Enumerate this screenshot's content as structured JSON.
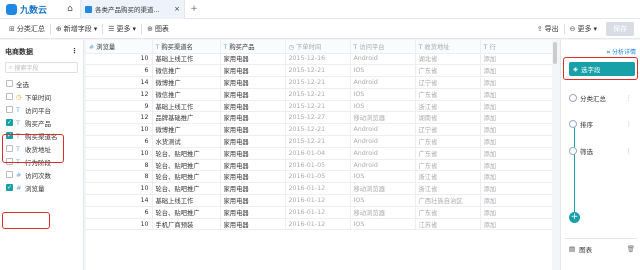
{
  "app": {
    "logo_text": "九数云",
    "tab_title": "各类产品购买的渠道...",
    "home_icon": "home-icon"
  },
  "toolbar": {
    "group_label": "分类汇总",
    "add_field_label": "新增字段",
    "more_label": "更多",
    "chart_label": "图表",
    "export_label": "导出",
    "more2_label": "更多",
    "save_label": "保存"
  },
  "left_panel": {
    "title": "电商数据",
    "search_placeholder": "搜索字段",
    "select_all": "全选",
    "fields": [
      {
        "name": "下单时间",
        "type": "clock",
        "checked": false
      },
      {
        "name": "访问平台",
        "type": "T",
        "checked": false
      },
      {
        "name": "购买产品",
        "type": "T",
        "checked": true
      },
      {
        "name": "购买渠道名",
        "type": "T",
        "checked": true
      },
      {
        "name": "收货地址",
        "type": "T",
        "checked": false
      },
      {
        "name": "行为阶段",
        "type": "T",
        "checked": false
      },
      {
        "name": "访问次数",
        "type": "#",
        "checked": false
      },
      {
        "name": "浏览量",
        "type": "#",
        "checked": true
      }
    ]
  },
  "table": {
    "columns": [
      "浏览量",
      "购买渠道名",
      "购买产品",
      "下单时间",
      "访问平台",
      "收货地址",
      "行"
    ],
    "rows": [
      [
        "10",
        "基础上线工作",
        "家用电器",
        "2015-12-16",
        "Android",
        "湖北省",
        "添加"
      ],
      [
        "6",
        "微信推广",
        "家用电器",
        "2015-12-21",
        "IOS",
        "广东省",
        "添加"
      ],
      [
        "14",
        "微博推广",
        "家用电器",
        "2015-12-21",
        "Android",
        "辽宁省",
        "添加"
      ],
      [
        "12",
        "微信推广",
        "家用电器",
        "2015-12-21",
        "IOS",
        "广东省",
        "添加"
      ],
      [
        "9",
        "基础上线工作",
        "家用电器",
        "2015-12-21",
        "IOS",
        "浙江省",
        "添加"
      ],
      [
        "12",
        "品牌基础推广",
        "家用电器",
        "2015-12-27",
        "移动浏览器",
        "湖南省",
        "添加"
      ],
      [
        "10",
        "微博推广",
        "家用电器",
        "2015-12-21",
        "Android",
        "辽宁省",
        "添加"
      ],
      [
        "6",
        "水货测试",
        "家用电器",
        "2015-12-21",
        "Android",
        "广东省",
        "添加"
      ],
      [
        "10",
        "轮台、贴吧推广",
        "家用电器",
        "2016-01-04",
        "Android",
        "广东省",
        "添加"
      ],
      [
        "8",
        "轮台、贴吧推广",
        "家用电器",
        "2016-01-05",
        "Android",
        "广东省",
        "添加"
      ],
      [
        "8",
        "轮台、贴吧推广",
        "家用电器",
        "2016-01-05",
        "IOS",
        "浙江省",
        "添加"
      ],
      [
        "10",
        "轮台、贴吧推广",
        "家用电器",
        "2016-01-12",
        "移动浏览器",
        "浙江省",
        "添加"
      ],
      [
        "14",
        "基础上线工作",
        "家用电器",
        "2016-01-12",
        "IOS",
        "广西壮族自治区",
        "添加"
      ],
      [
        "6",
        "轮台、贴吧推广",
        "家用电器",
        "2016-01-12",
        "移动浏览器",
        "广东省",
        "添加"
      ],
      [
        "10",
        "手机厂商预装",
        "家用电器",
        "2016-01-12",
        "IOS",
        "江苏省",
        "添加"
      ]
    ]
  },
  "right_panel": {
    "analyze_link": "分析详情",
    "steps": [
      {
        "label": "选字段",
        "active": true
      },
      {
        "label": "分类汇总",
        "active": false
      },
      {
        "label": "排序",
        "active": false
      },
      {
        "label": "筛选",
        "active": false
      }
    ],
    "chart_label": "图表"
  },
  "colors": {
    "accent": "#17a0a8",
    "highlight": "#d93025",
    "brand": "#1e88e5"
  }
}
